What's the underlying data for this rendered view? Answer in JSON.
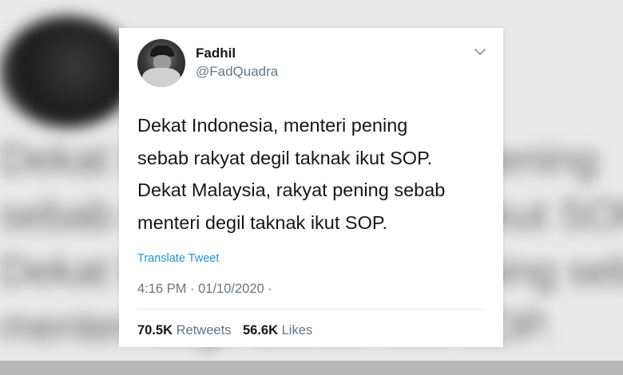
{
  "tweet": {
    "display_name": "Fadhil",
    "handle": "@FadQuadra",
    "lines": [
      "Dekat Indonesia, menteri pening",
      "sebab rakyat degil taknak ikut SOP.",
      "Dekat Malaysia, rakyat pening sebab",
      "menteri degil taknak ikut SOP."
    ],
    "translate_label": "Translate Tweet",
    "timestamp": "4:16 PM · 01/10/2020 ·",
    "retweets_count": "70.5K",
    "retweets_label": "Retweets",
    "likes_count": "56.6K",
    "likes_label": "Likes"
  },
  "colors": {
    "link": "#1b95e0",
    "muted": "#657786",
    "text": "#14171a"
  },
  "icons": {
    "menu": "chevron-down-icon"
  }
}
